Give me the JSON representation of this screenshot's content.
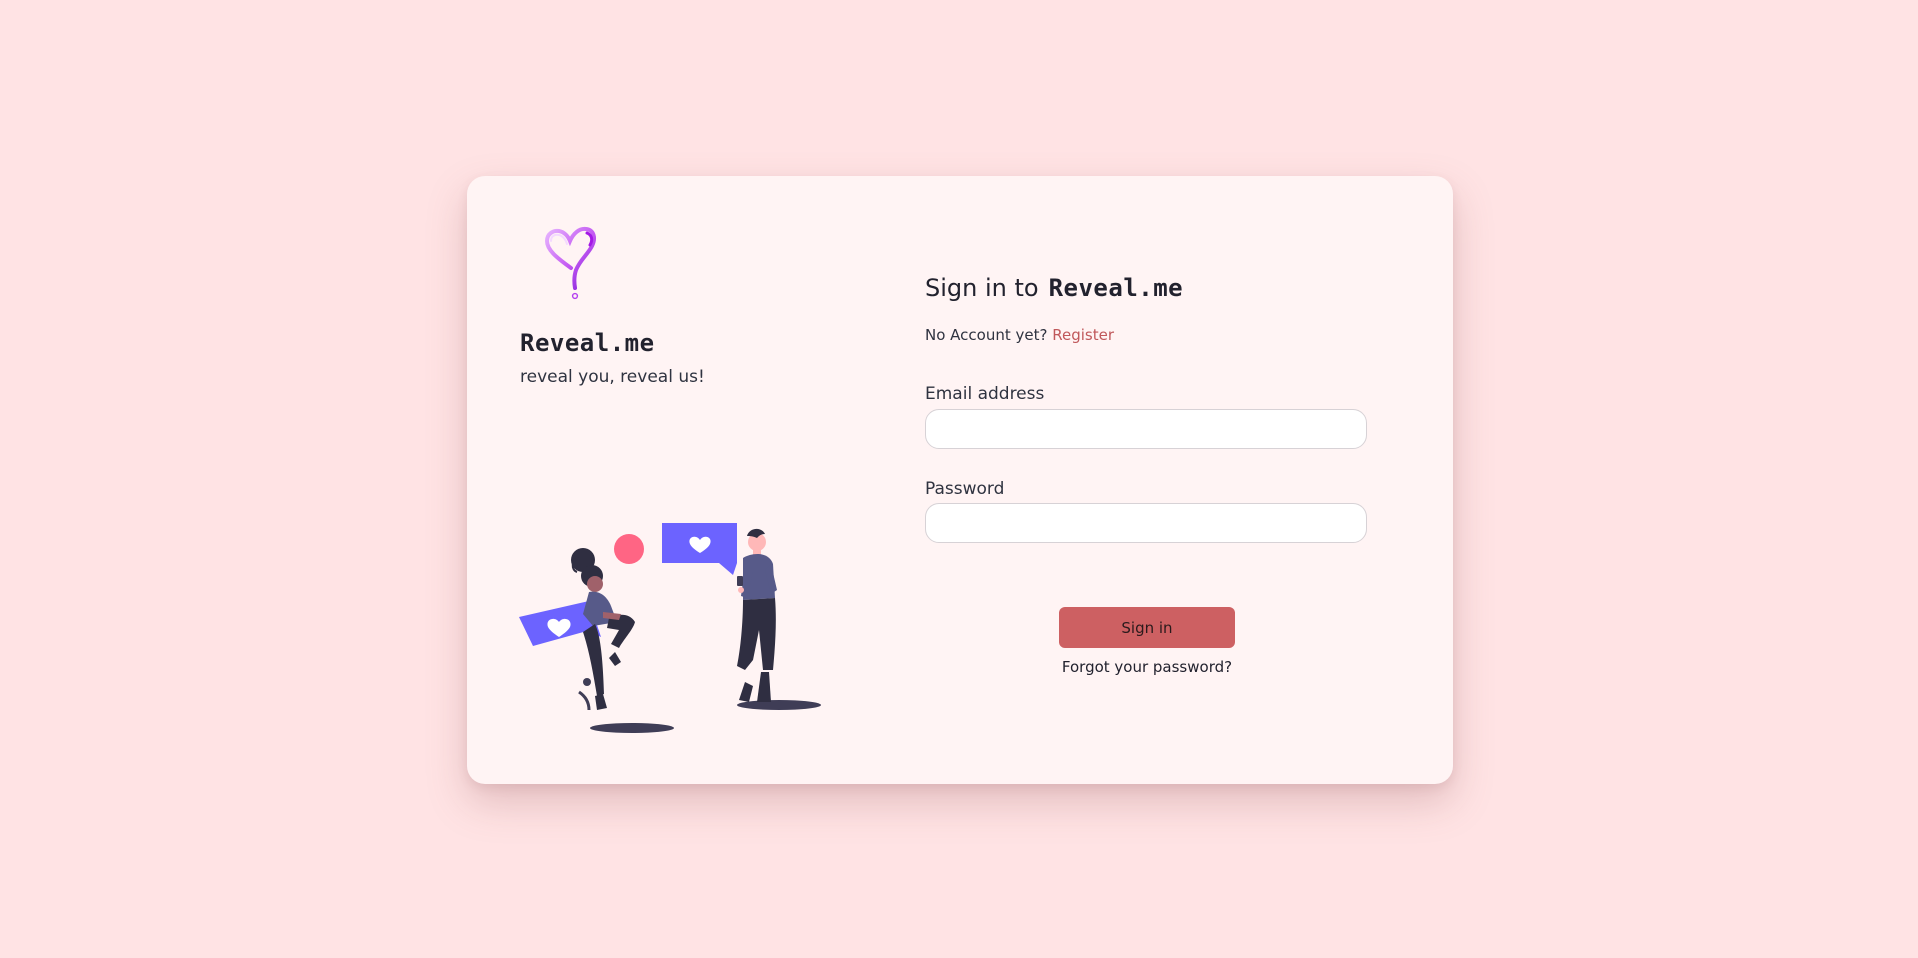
{
  "brand": {
    "name": "Reveal.me",
    "tagline": "reveal you, reveal us!",
    "logo_icon": "heart-question-mark-icon"
  },
  "signin": {
    "title_prefix": "Sign in to",
    "title_brand": "Reveal.me",
    "no_account_text": "No Account yet?",
    "register_label": "Register",
    "email_label": "Email address",
    "email_value": "",
    "password_label": "Password",
    "password_value": "",
    "submit_label": "Sign in",
    "forgot_label": "Forgot your password?"
  },
  "colors": {
    "page_background": "#ffe3e4",
    "card_background": "#fff4f4",
    "accent": "#cd6062",
    "link": "#c0585b",
    "illustration_purple": "#6c63ff",
    "illustration_pink": "#ff6584"
  },
  "illustration": {
    "name": "couple-chat-illustration"
  }
}
